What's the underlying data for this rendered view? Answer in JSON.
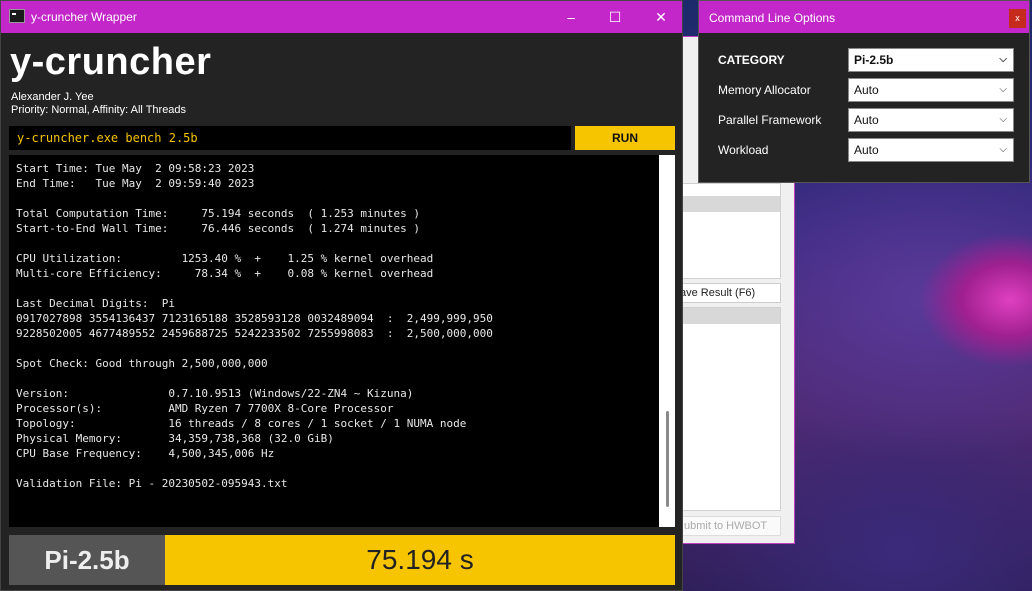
{
  "main_window": {
    "title": "y-cruncher Wrapper",
    "brand": "y-cruncher",
    "author": "Alexander J. Yee",
    "priority": "Priority: Normal, Affinity: All Threads",
    "command": "y-cruncher.exe bench 2.5b",
    "run_label": "RUN",
    "output_lines": [
      "Start Time: Tue May  2 09:58:23 2023",
      "End Time:   Tue May  2 09:59:40 2023",
      "",
      "Total Computation Time:     75.194 seconds  ( 1.253 minutes )",
      "Start-to-End Wall Time:     76.446 seconds  ( 1.274 minutes )",
      "",
      "CPU Utilization:         1253.40 %  +    1.25 % kernel overhead",
      "Multi-core Efficiency:     78.34 %  +    0.08 % kernel overhead",
      "",
      "Last Decimal Digits:  Pi",
      "0917027898 3554136437 7123165188 3528593128 0032489094  :  2,499,999,950",
      "9228502005 4677489552 2459688725 5242233502 7255998083  :  2,500,000,000",
      "",
      "Spot Check: Good through 2,500,000,000",
      "",
      "Version:               0.7.10.9513 (Windows/22-ZN4 ~ Kizuna)",
      "Processor(s):          AMD Ryzen 7 7700X 8-Core Processor",
      "Topology:              16 threads / 8 cores / 1 socket / 1 NUMA node",
      "Physical Memory:       34,359,738,368 (32.0 GiB)",
      "CPU Base Frequency:    4,500,345,006 Hz",
      "",
      "Validation File: Pi - 20230502-095943.txt"
    ],
    "bench_label": "Pi-2.5b",
    "bench_time": "75.194 s"
  },
  "background_window": {
    "save_result_label": "ave Result (F6)",
    "submit_label": "ubmit to HWBOT"
  },
  "options_window": {
    "title": "Command Line Options",
    "close_label": "x",
    "rows": [
      {
        "label": "CATEGORY",
        "value": "Pi-2.5b"
      },
      {
        "label": "Memory Allocator",
        "value": "Auto"
      },
      {
        "label": "Parallel Framework",
        "value": "Auto"
      },
      {
        "label": "Workload",
        "value": "Auto"
      }
    ]
  },
  "icons": {
    "minimize": "minimize-icon",
    "maximize": "maximize-icon",
    "close": "close-icon",
    "dropdown": "chevron-down-icon"
  },
  "colors": {
    "titlebar": "#c326c9",
    "accent": "#f7c500",
    "terminal_bg": "#000000",
    "window_bg": "#232323"
  }
}
